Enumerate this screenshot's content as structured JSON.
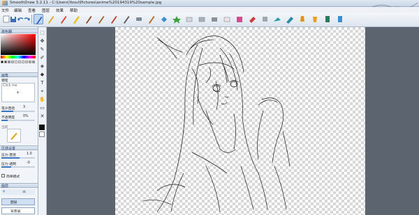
{
  "window": {
    "title": "SmoothDraw 3.2.11 - C:\\Users\\Yosui\\Pictures\\anime%20194319%20sample.jpg"
  },
  "menu": [
    "文件",
    "编辑",
    "查看",
    "图层",
    "效果",
    "帮助"
  ],
  "toolbar": {
    "tools": [
      "pen-icon",
      "pencil-icon",
      "red-pencil-icon",
      "marker-icon",
      "brush-icon",
      "brush-2-icon",
      "brush-3-icon",
      "ink-pen-icon",
      "airbrush-icon",
      "blur-icon",
      "fill-bucket-icon",
      "palette-icon",
      "eraser-icon",
      "eraser-2-icon",
      "smudge-icon",
      "grass-icon",
      "spray-icon",
      "spray-2-icon",
      "stamp-icon",
      "ink-bottle-icon"
    ]
  },
  "panel": {
    "color_section": "拾色器",
    "brush_section": "画笔",
    "brush_name_label": "钢笔",
    "brush_sub": "Click me",
    "size_label": "笔尖直径",
    "size_value": "3",
    "opacity_label": "不透明度",
    "opacity_value": "0%",
    "current_label": "当前",
    "pressure_section": "压感设置",
    "pressure_size_label": "压力-直径",
    "pressure_size_value": "1.0",
    "pressure_alpha_label": "压力-透明",
    "pressure_alpha_value": "-0",
    "simple_mode_label": "简单模式",
    "layers_section": "图层",
    "layer1": "图层",
    "layer2": "背景层",
    "progress": {
      "size": 0.35,
      "opacity": 0.18,
      "pressure_size": 0.55,
      "pressure_alpha": 0.3
    }
  },
  "colors": {
    "accent": "#3a75c4",
    "swatches": [
      "#000000",
      "#404040",
      "#808080",
      "#c0c0c0",
      "#ffffff",
      "#ff0000",
      "#00ff00",
      "#0000ff",
      "#ffff00",
      "#ff00ff"
    ]
  }
}
